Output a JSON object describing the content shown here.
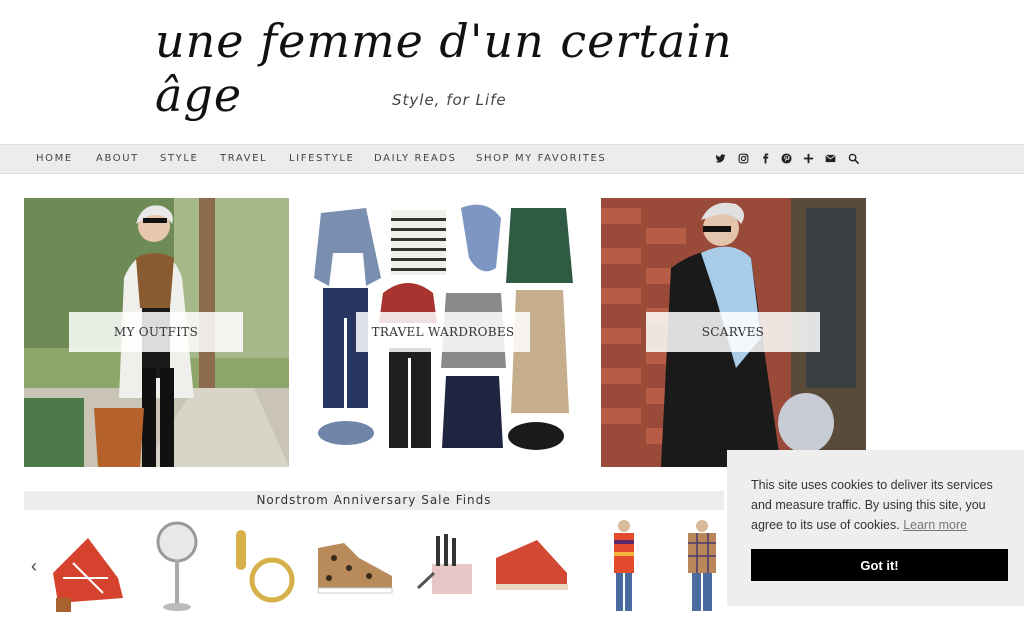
{
  "site": {
    "title": "une femme d'un certain âge",
    "tagline": "Style, for Life"
  },
  "nav": {
    "items": [
      "Home",
      "About",
      "Style",
      "Travel",
      "Lifestyle",
      "Daily Reads",
      "Shop My Favorites"
    ],
    "social_icons": [
      "twitter-icon",
      "instagram-icon",
      "facebook-icon",
      "pinterest-icon",
      "bloglovin-icon",
      "email-icon",
      "search-icon"
    ]
  },
  "promos": [
    {
      "label": "My Outfits"
    },
    {
      "label": "Travel Wardrobes"
    },
    {
      "label": "Scarves"
    }
  ],
  "carousel": {
    "title": "Nordstrom Anniversary Sale Finds",
    "prev_icon": "chevron-left-icon",
    "products": [
      "red-sandal",
      "lighted-mirror",
      "gold-hoop-earrings",
      "leopard-sneaker",
      "makeup-brush-set",
      "red-wedge-sandal",
      "striped-scarf-outfit",
      "plaid-blazer-outfit"
    ]
  },
  "cookie": {
    "message": "This site uses cookies to deliver its services and measure traffic. By using this site, you agree to its use of cookies.",
    "link": "Learn more",
    "button": "Got it!"
  },
  "colors": {
    "nav_bg": "#ececec",
    "cookie_bg": "#eeeeee",
    "cookie_button": "#000000"
  }
}
